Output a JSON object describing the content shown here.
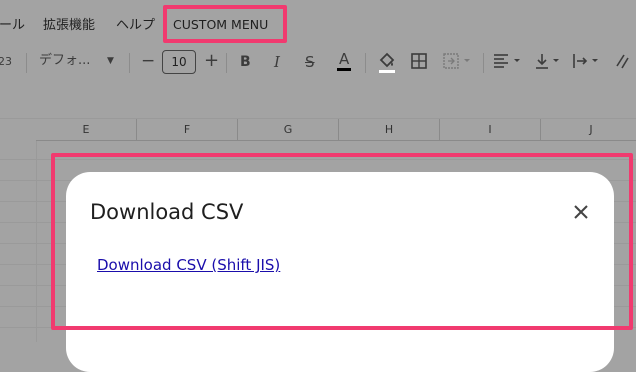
{
  "menubar": {
    "items": [
      "ール",
      "拡張機能",
      "ヘルプ"
    ],
    "custom_menu": "CUSTOM MENU"
  },
  "toolbar": {
    "format_hint": "23",
    "font_name": "デフォ...",
    "decrease_label": "−",
    "font_size": "10",
    "increase_label": "+",
    "bold_label": "B",
    "italic_label": "I",
    "strike_label": "S",
    "text_color_label": "A",
    "text_color": "#000000"
  },
  "grid": {
    "columns": [
      "E",
      "F",
      "G",
      "H",
      "I",
      "J"
    ]
  },
  "dialog": {
    "title": "Download CSV",
    "link": "Download CSV (Shift JIS)",
    "close_icon": "close-icon"
  },
  "colors": {
    "highlight": "#f13a6f",
    "overlay": "#a3a3a3",
    "link": "#1a0dab"
  }
}
